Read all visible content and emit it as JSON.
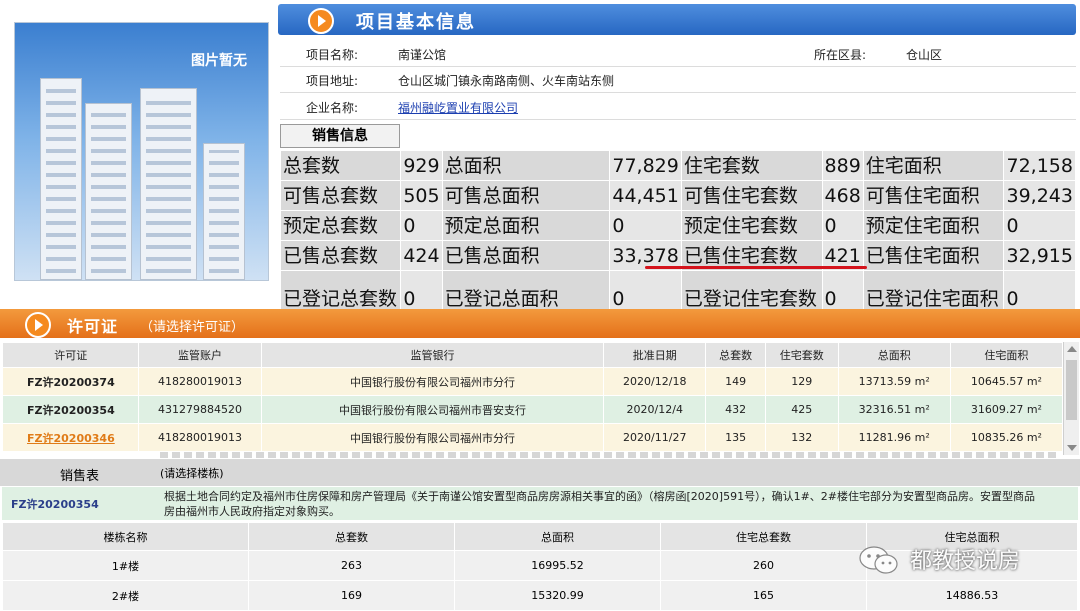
{
  "photo": {
    "caption": "图片暂无"
  },
  "project_info": {
    "header_title": "项目基本信息",
    "name_label": "项目名称:",
    "name_value": "南谨公馆",
    "district_label": "所在区县:",
    "district_value": "仓山区",
    "address_label": "项目地址:",
    "address_value": "仓山区城门镇永南路南侧、火车南站东侧",
    "company_label": "企业名称:",
    "company_value": "福州融屹置业有限公司"
  },
  "sales_info": {
    "tab_label": "销售信息",
    "rows": [
      [
        {
          "l": "总套数",
          "v": "929"
        },
        {
          "l": "总面积",
          "v": "77,829"
        },
        {
          "l": "住宅套数",
          "v": "889"
        },
        {
          "l": "住宅面积",
          "v": "72,158"
        }
      ],
      [
        {
          "l": "可售总套数",
          "v": "505"
        },
        {
          "l": "可售总面积",
          "v": "44,451"
        },
        {
          "l": "可售住宅套数",
          "v": "468"
        },
        {
          "l": "可售住宅面积",
          "v": "39,243"
        }
      ],
      [
        {
          "l": "预定总套数",
          "v": "0"
        },
        {
          "l": "预定总面积",
          "v": "0"
        },
        {
          "l": "预定住宅套数",
          "v": "0"
        },
        {
          "l": "预定住宅面积",
          "v": "0"
        }
      ],
      [
        {
          "l": "已售总套数",
          "v": "424"
        },
        {
          "l": "已售总面积",
          "v": "33,378"
        },
        {
          "l": "已售住宅套数",
          "v": "421"
        },
        {
          "l": "已售住宅面积",
          "v": "32,915"
        }
      ],
      [
        {
          "l": "已登记总套数",
          "v": "0"
        },
        {
          "l": "已登记总面积",
          "v": "0"
        },
        {
          "l": "已登记住宅套数",
          "v": "0"
        },
        {
          "l": "已登记住宅面积",
          "v": "0"
        }
      ]
    ]
  },
  "permits": {
    "header_title": "许可证",
    "header_hint": "（请选择许可证）",
    "columns": [
      "许可证",
      "监管账户",
      "监管银行",
      "批准日期",
      "总套数",
      "住宅套数",
      "总面积",
      "住宅面积"
    ],
    "rows": [
      [
        "FZ许20200374",
        "418280019013",
        "中国银行股份有限公司福州市分行",
        "2020/12/18",
        "149",
        "129",
        "13713.59 m²",
        "10645.57 m²"
      ],
      [
        "FZ许20200354",
        "431279884520",
        "中国银行股份有限公司福州市晋安支行",
        "2020/12/4",
        "432",
        "425",
        "32316.51 m²",
        "31609.27 m²"
      ],
      [
        "FZ许20200346",
        "418280019013",
        "中国银行股份有限公司福州市分行",
        "2020/11/27",
        "135",
        "132",
        "11281.96 m²",
        "10835.26 m²"
      ]
    ]
  },
  "sales_table": {
    "title": "销售表",
    "hint": "(请选择楼栋)",
    "selected_permit": "FZ许20200354",
    "note": "根据土地合同约定及福州市住房保障和房产管理局《关于南谨公馆安置型商品房房源相关事宜的函》（榕房函[2020]591号），确认1#、2#楼住宅部分为安置型商品房。安置型商品房由福州市人民政府指定对象购买。",
    "columns": [
      "楼栋名称",
      "总套数",
      "总面积",
      "住宅总套数",
      "住宅总面积"
    ],
    "rows": [
      [
        "1#楼",
        "263",
        "16995.52",
        "260",
        ""
      ],
      [
        "2#楼",
        "169",
        "15320.99",
        "165",
        "14886.53"
      ]
    ]
  },
  "watermark": {
    "text": "都教授说房"
  },
  "colors": {
    "blue_header": "#2767c2",
    "orange_header": "#e4701a",
    "highlight_red": "#d4131c",
    "row_green": "#dff0e3",
    "row_cream": "#fbf4df"
  }
}
